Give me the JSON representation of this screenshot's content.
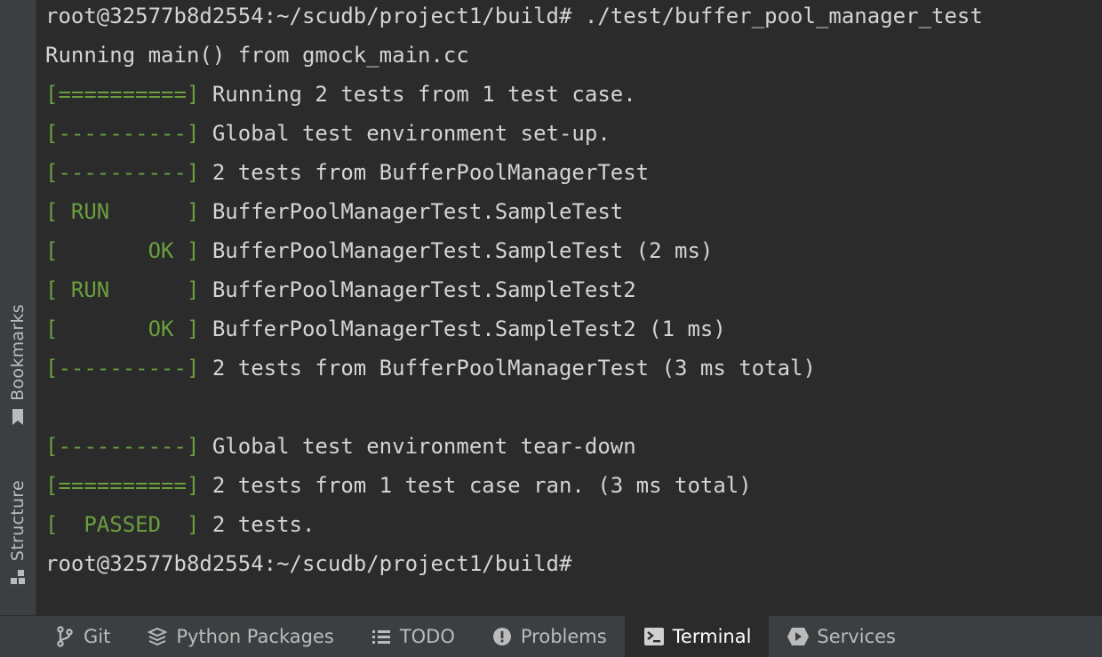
{
  "side_tabs": [
    {
      "id": "bookmarks",
      "label": "Bookmarks",
      "icon": "bookmark-icon"
    },
    {
      "id": "structure",
      "label": "Structure",
      "icon": "structure-icon"
    }
  ],
  "terminal": {
    "lines": [
      {
        "text": "root@32577b8d2554:~/scudb/project1/build# ./test/buffer_pool_manager_test"
      },
      {
        "text": "Running main() from gmock_main.cc"
      },
      {
        "tag": "[==========]",
        "text": " Running 2 tests from 1 test case."
      },
      {
        "tag": "[----------]",
        "text": " Global test environment set-up."
      },
      {
        "tag": "[----------]",
        "text": " 2 tests from BufferPoolManagerTest"
      },
      {
        "tag": "[ RUN      ]",
        "text": " BufferPoolManagerTest.SampleTest"
      },
      {
        "tag": "[       OK ]",
        "text": " BufferPoolManagerTest.SampleTest (2 ms)"
      },
      {
        "tag": "[ RUN      ]",
        "text": " BufferPoolManagerTest.SampleTest2"
      },
      {
        "tag": "[       OK ]",
        "text": " BufferPoolManagerTest.SampleTest2 (1 ms)"
      },
      {
        "tag": "[----------]",
        "text": " 2 tests from BufferPoolManagerTest (3 ms total)"
      },
      {
        "text": ""
      },
      {
        "tag": "[----------]",
        "text": " Global test environment tear-down"
      },
      {
        "tag": "[==========]",
        "text": " 2 tests from 1 test case ran. (3 ms total)"
      },
      {
        "tag": "[  PASSED  ]",
        "text": " 2 tests."
      },
      {
        "text": "root@32577b8d2554:~/scudb/project1/build#"
      }
    ]
  },
  "bottom_tabs": [
    {
      "id": "git",
      "label": "Git",
      "icon": "git-branch-icon",
      "active": false
    },
    {
      "id": "python-packages",
      "label": "Python Packages",
      "icon": "python-packages-icon",
      "active": false
    },
    {
      "id": "todo",
      "label": "TODO",
      "icon": "todo-list-icon",
      "active": false
    },
    {
      "id": "problems",
      "label": "Problems",
      "icon": "problems-icon",
      "active": false
    },
    {
      "id": "terminal",
      "label": "Terminal",
      "icon": "terminal-icon",
      "active": true
    },
    {
      "id": "services",
      "label": "Services",
      "icon": "services-icon",
      "active": false
    }
  ],
  "colors": {
    "background": "#2b2b2b",
    "panel": "#3c3f41",
    "text": "#d4d4d4",
    "test_tag": "#6a9f3e"
  }
}
